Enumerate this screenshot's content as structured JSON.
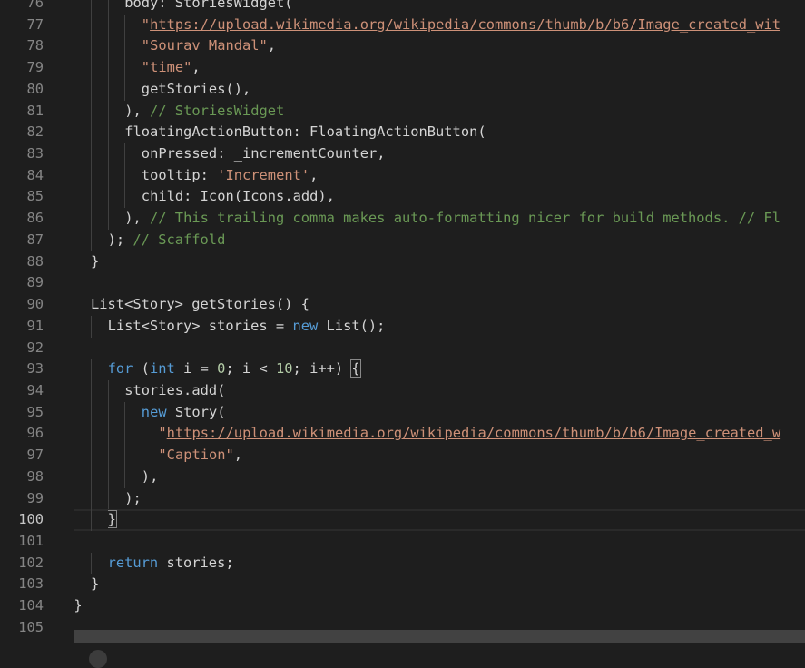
{
  "editor": {
    "current_line": 100,
    "lines": [
      {
        "n": "76",
        "indent": 2,
        "tokens": [
          {
            "t": "body: StoriesWidget(",
            "c": "plain"
          }
        ]
      },
      {
        "n": "77",
        "indent": 3,
        "tokens": [
          {
            "t": "\"",
            "c": "string"
          },
          {
            "t": "https://upload.wikimedia.org/wikipedia/commons/thumb/b/b6/Image_created_wit",
            "c": "link"
          }
        ]
      },
      {
        "n": "78",
        "indent": 3,
        "tokens": [
          {
            "t": "\"Sourav Mandal\"",
            "c": "string"
          },
          {
            "t": ",",
            "c": "plain"
          }
        ]
      },
      {
        "n": "79",
        "indent": 3,
        "tokens": [
          {
            "t": "\"time\"",
            "c": "string"
          },
          {
            "t": ",",
            "c": "plain"
          }
        ]
      },
      {
        "n": "80",
        "indent": 3,
        "tokens": [
          {
            "t": "getStories(),",
            "c": "plain"
          }
        ]
      },
      {
        "n": "81",
        "indent": 2,
        "tokens": [
          {
            "t": "), ",
            "c": "plain"
          },
          {
            "t": "// StoriesWidget",
            "c": "comment"
          }
        ]
      },
      {
        "n": "82",
        "indent": 2,
        "tokens": [
          {
            "t": "floatingActionButton: FloatingActionButton(",
            "c": "plain"
          }
        ]
      },
      {
        "n": "83",
        "indent": 3,
        "tokens": [
          {
            "t": "onPressed: _incrementCounter,",
            "c": "plain"
          }
        ]
      },
      {
        "n": "84",
        "indent": 3,
        "tokens": [
          {
            "t": "tooltip: ",
            "c": "plain"
          },
          {
            "t": "'Increment'",
            "c": "string"
          },
          {
            "t": ",",
            "c": "plain"
          }
        ]
      },
      {
        "n": "85",
        "indent": 3,
        "tokens": [
          {
            "t": "child: Icon(Icons.add),",
            "c": "plain"
          }
        ]
      },
      {
        "n": "86",
        "indent": 2,
        "tokens": [
          {
            "t": "), ",
            "c": "plain"
          },
          {
            "t": "// This trailing comma makes auto-formatting nicer for build methods. // Fl",
            "c": "comment"
          }
        ]
      },
      {
        "n": "87",
        "indent": 1,
        "tokens": [
          {
            "t": "); ",
            "c": "plain"
          },
          {
            "t": "// Scaffold",
            "c": "comment"
          }
        ]
      },
      {
        "n": "88",
        "indent": 0,
        "tokens": [
          {
            "t": "}",
            "c": "plain"
          }
        ]
      },
      {
        "n": "89",
        "indent": 0,
        "tokens": []
      },
      {
        "n": "90",
        "indent": 0,
        "tokens": [
          {
            "t": "List<Story> getStories() {",
            "c": "plain"
          }
        ]
      },
      {
        "n": "91",
        "indent": 1,
        "tokens": [
          {
            "t": "List<Story> stories = ",
            "c": "plain"
          },
          {
            "t": "new",
            "c": "keyword"
          },
          {
            "t": " List();",
            "c": "plain"
          }
        ]
      },
      {
        "n": "92",
        "indent": 0,
        "tokens": []
      },
      {
        "n": "93",
        "indent": 1,
        "tokens": [
          {
            "t": "for",
            "c": "keyword"
          },
          {
            "t": " (",
            "c": "plain"
          },
          {
            "t": "int",
            "c": "keyword"
          },
          {
            "t": " i = ",
            "c": "plain"
          },
          {
            "t": "0",
            "c": "number"
          },
          {
            "t": "; i < ",
            "c": "plain"
          },
          {
            "t": "10",
            "c": "number"
          },
          {
            "t": "; i++) ",
            "c": "plain"
          },
          {
            "t": "{",
            "c": "bracket-hl"
          }
        ]
      },
      {
        "n": "94",
        "indent": 2,
        "tokens": [
          {
            "t": "stories.add(",
            "c": "plain"
          }
        ]
      },
      {
        "n": "95",
        "indent": 3,
        "tokens": [
          {
            "t": "new",
            "c": "keyword"
          },
          {
            "t": " Story(",
            "c": "plain"
          }
        ]
      },
      {
        "n": "96",
        "indent": 4,
        "tokens": [
          {
            "t": "\"",
            "c": "string"
          },
          {
            "t": "https://upload.wikimedia.org/wikipedia/commons/thumb/b/b6/Image_created_w",
            "c": "link"
          }
        ]
      },
      {
        "n": "97",
        "indent": 4,
        "tokens": [
          {
            "t": "\"Caption\"",
            "c": "string"
          },
          {
            "t": ",",
            "c": "plain"
          }
        ]
      },
      {
        "n": "98",
        "indent": 3,
        "tokens": [
          {
            "t": "),",
            "c": "plain"
          }
        ]
      },
      {
        "n": "99",
        "indent": 2,
        "tokens": [
          {
            "t": ");",
            "c": "plain"
          }
        ]
      },
      {
        "n": "100",
        "indent": 1,
        "tokens": [
          {
            "t": "}",
            "c": "bracket-hl"
          }
        ]
      },
      {
        "n": "101",
        "indent": 0,
        "tokens": []
      },
      {
        "n": "102",
        "indent": 1,
        "tokens": [
          {
            "t": "return",
            "c": "keyword"
          },
          {
            "t": " stories;",
            "c": "plain"
          }
        ]
      },
      {
        "n": "103",
        "indent": 0,
        "tokens": [
          {
            "t": "}",
            "c": "plain"
          }
        ]
      },
      {
        "n": "104",
        "indent": -1,
        "tokens": [
          {
            "t": "}",
            "c": "plain"
          }
        ]
      },
      {
        "n": "105",
        "indent": 0,
        "tokens": []
      }
    ]
  }
}
